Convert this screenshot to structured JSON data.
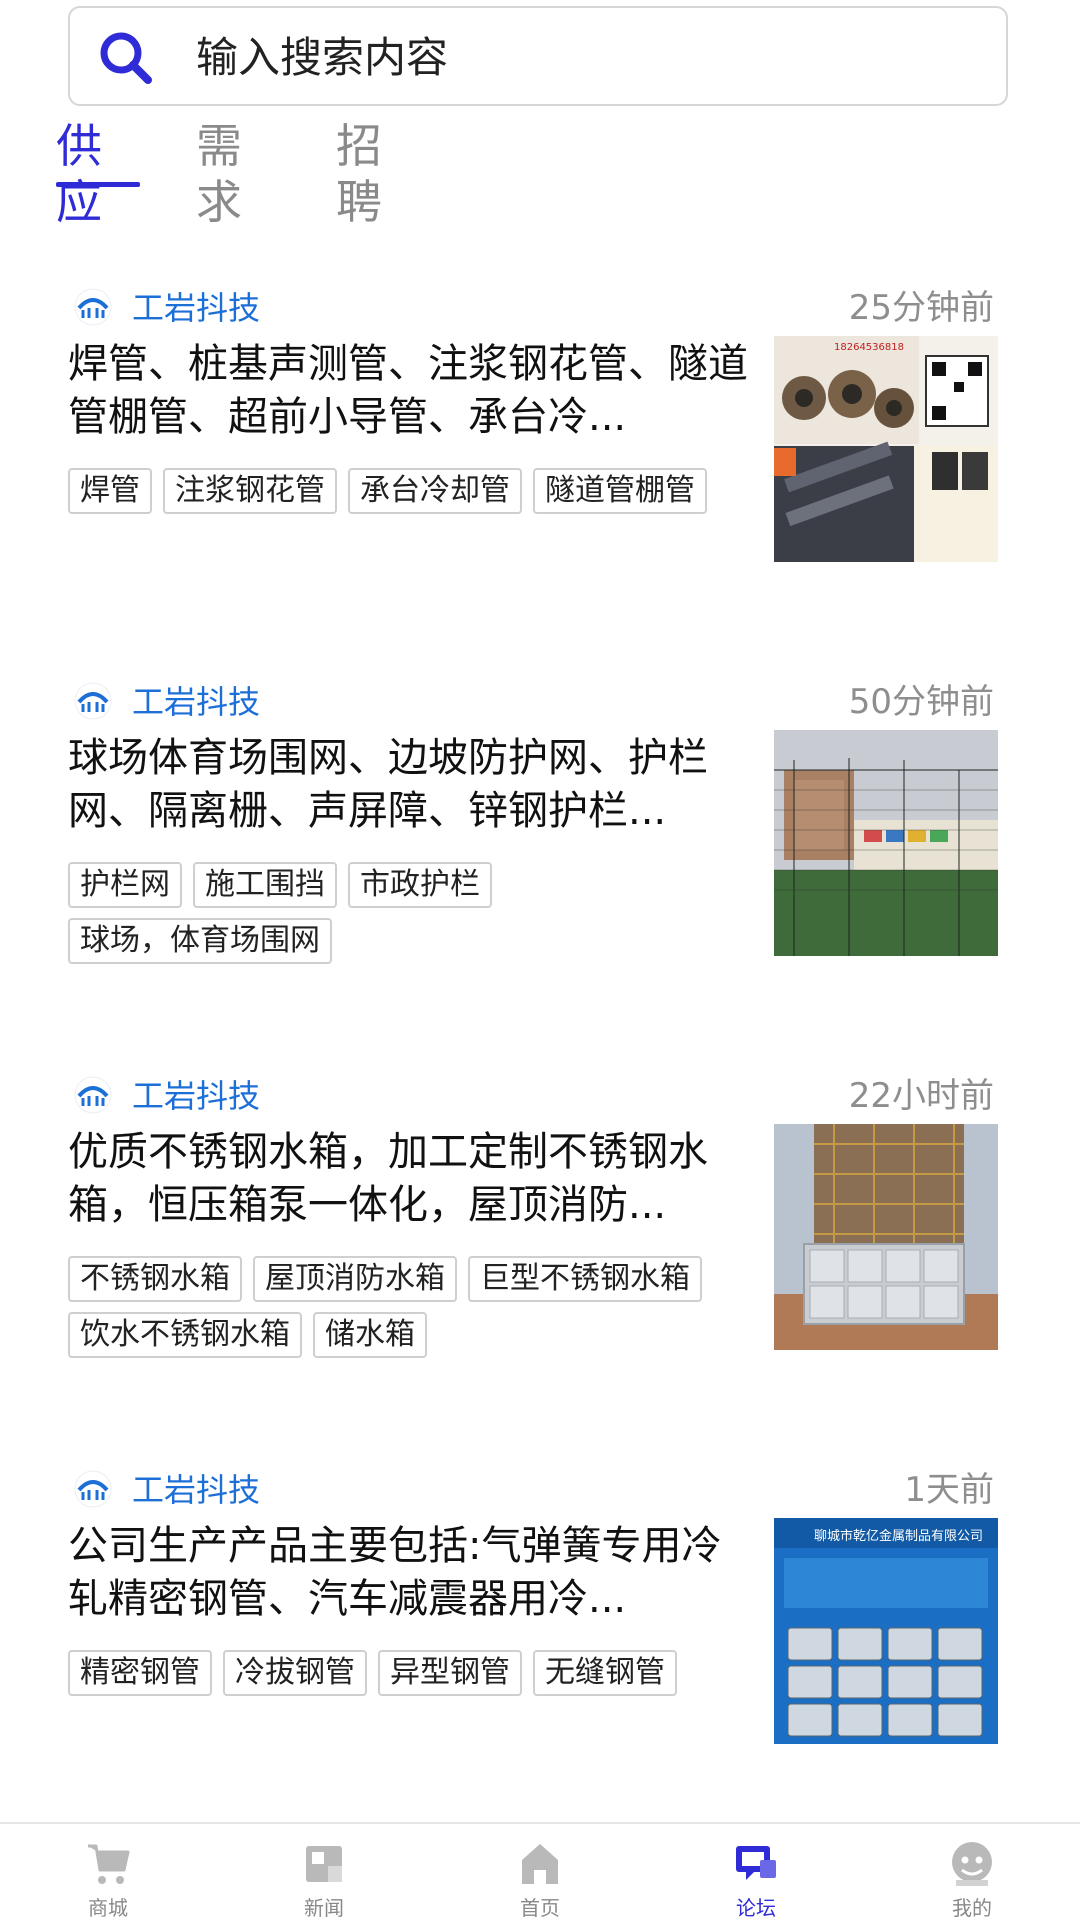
{
  "search": {
    "placeholder": "输入搜索内容"
  },
  "tabs": [
    {
      "label": "供应",
      "active": true
    },
    {
      "label": "需求",
      "active": false
    },
    {
      "label": "招聘",
      "active": false
    }
  ],
  "posts": [
    {
      "author": "工岩抖技",
      "time": "25分钟前",
      "title": "焊管、桩基声测管、注浆钢花管、隧道管棚管、超前小导管、承台冷...",
      "tags": [
        "焊管",
        "注浆钢花管",
        "承台冷却管",
        "隧道管棚管"
      ],
      "thumb_caption": "18264536818"
    },
    {
      "author": "工岩抖技",
      "time": "50分钟前",
      "title": "球场体育场围网、边坡防护网、护栏网、隔离栅、声屏障、锌钢护栏...",
      "tags": [
        "护栏网",
        "施工围挡",
        "市政护栏",
        "球场，体育场围网"
      ]
    },
    {
      "author": "工岩抖技",
      "time": "22小时前",
      "title": "优质不锈钢水箱，加工定制不锈钢水箱，恒压箱泵一体化，屋顶消防...",
      "tags": [
        "不锈钢水箱",
        "屋顶消防水箱",
        "巨型不锈钢水箱",
        "饮水不锈钢水箱",
        "储水箱"
      ]
    },
    {
      "author": "工岩抖技",
      "time": "1天前",
      "title": "公司生产产品主要包括:气弹簧专用冷轧精密钢管、汽车减震器用冷...",
      "tags": [
        "精密钢管",
        "冷拔钢管",
        "异型钢管",
        "无缝钢管"
      ],
      "thumb_caption": "聊城市乾亿金属制品有限公司"
    }
  ],
  "bottom_nav": [
    {
      "label": "商城",
      "icon": "cart-icon",
      "active": false
    },
    {
      "label": "新闻",
      "icon": "news-icon",
      "active": false
    },
    {
      "label": "首页",
      "icon": "home-icon",
      "active": false
    },
    {
      "label": "论坛",
      "icon": "forum-icon",
      "active": true
    },
    {
      "label": "我的",
      "icon": "profile-icon",
      "active": false
    }
  ],
  "colors": {
    "accent": "#2f2bd6",
    "author": "#1d6fd8",
    "muted": "#8e8e8e"
  }
}
